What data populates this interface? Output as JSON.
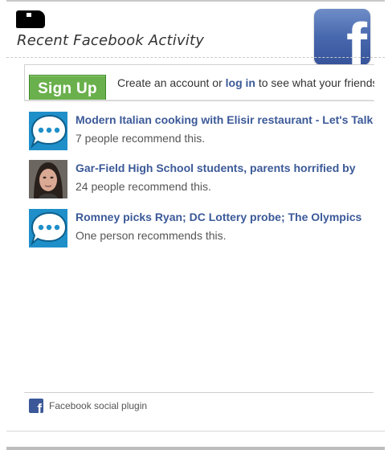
{
  "header": {
    "title": "Recent Facebook Activity",
    "corner_logo_icon": "redacted-logo-icon",
    "brand_icon": "facebook-logo-icon",
    "brand_letter": "f"
  },
  "signup": {
    "button_label": "Sign Up",
    "text_before": "Create an account or ",
    "login_link": "log in",
    "text_after": " to see what your friends are doing."
  },
  "activity": [
    {
      "title": "Modern Italian cooking with Elisir restaurant - Let's Talk",
      "subtitle": "7 people recommend this.",
      "thumb_icon": "speech-bubble-icon"
    },
    {
      "title": "Gar-Field High School students, parents horrified by",
      "subtitle": "24 people recommend this.",
      "thumb_icon": "person-photo"
    },
    {
      "title": "Romney picks Ryan; DC Lottery probe; The Olympics",
      "subtitle": "One person recommends this.",
      "thumb_icon": "speech-bubble-icon"
    }
  ],
  "footer": {
    "icon": "facebook-f-icon",
    "label": "Facebook social plugin"
  },
  "colors": {
    "facebook_blue": "#3b5998",
    "signup_green": "#6ab04c",
    "thumb_blue": "#1f8fc9"
  }
}
